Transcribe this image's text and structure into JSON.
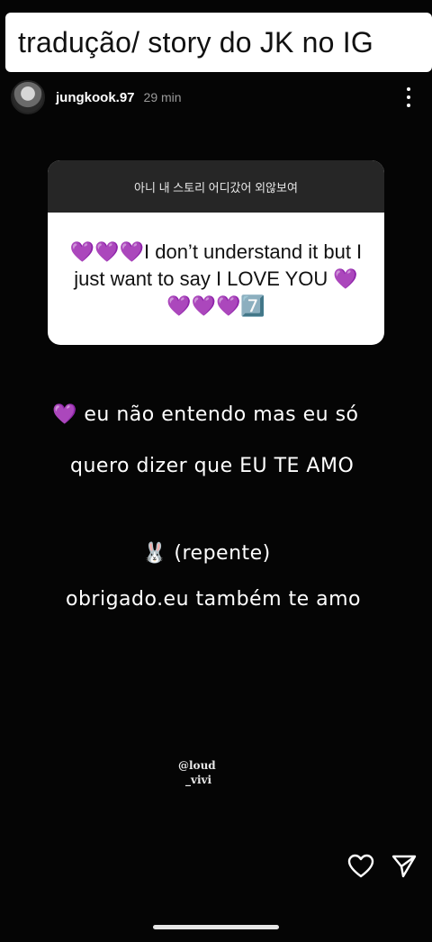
{
  "banner": {
    "title": "tradução/ story do JK no IG"
  },
  "header": {
    "username": "jungkook.97",
    "time": "29 min"
  },
  "question_box": {
    "prompt": "아니 내 스토리 어디갔어 외않보여",
    "answer": "💜💜💜I don’t understand it but I just want to say I LOVE YOU 💜💜💜💜7️⃣"
  },
  "story_text": {
    "line1": "💜 eu não entendo mas eu só",
    "line2": "quero dizer que EU TE AMO",
    "line3": "🐰 (repente)",
    "line4": "obrigado.eu também te amo"
  },
  "watermark": {
    "line1": "@loud",
    "line2": "_vivi"
  },
  "icons": {
    "heart": "heart-icon",
    "send": "send-icon",
    "more": "more-icon"
  },
  "colors": {
    "background": "#050505",
    "heart_emoji": "#9b4dff"
  }
}
